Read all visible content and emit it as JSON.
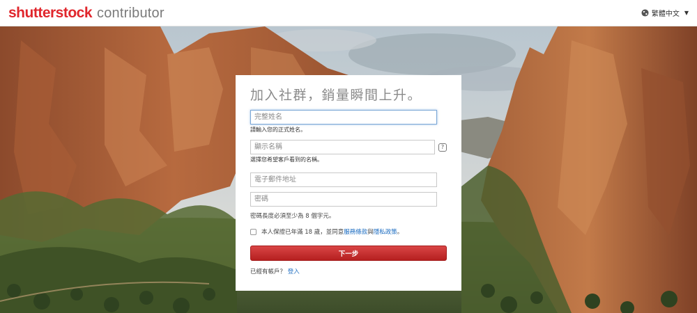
{
  "header": {
    "brand_main": "shutterstock",
    "brand_sub": "contributor",
    "language": "繁體中文",
    "language_caret": "▼"
  },
  "signup": {
    "title": "加入社群，銷量瞬間上升。",
    "full_name_placeholder": "完整姓名",
    "full_name_hint": "請輸入您的正式姓名。",
    "display_name_placeholder": "顯示名稱",
    "display_name_help": "?",
    "display_name_hint": "選擇您希望客戶看到的名稱。",
    "email_placeholder": "電子郵件地址",
    "password_placeholder": "密碼",
    "password_note": "密碼長度必須至少為 8 個字元。",
    "terms_prefix": "本人保證已年滿 18 歲，並同意",
    "terms_link": "服務條款",
    "terms_and": "與",
    "privacy_link": "隱私政策",
    "terms_suffix": "。",
    "next_button": "下一步",
    "have_account": "已經有帳戶？",
    "login_link": "登入"
  },
  "colors": {
    "brand_red": "#e0262c",
    "button_red": "#c62f2f",
    "link_blue": "#1a6bc0"
  }
}
